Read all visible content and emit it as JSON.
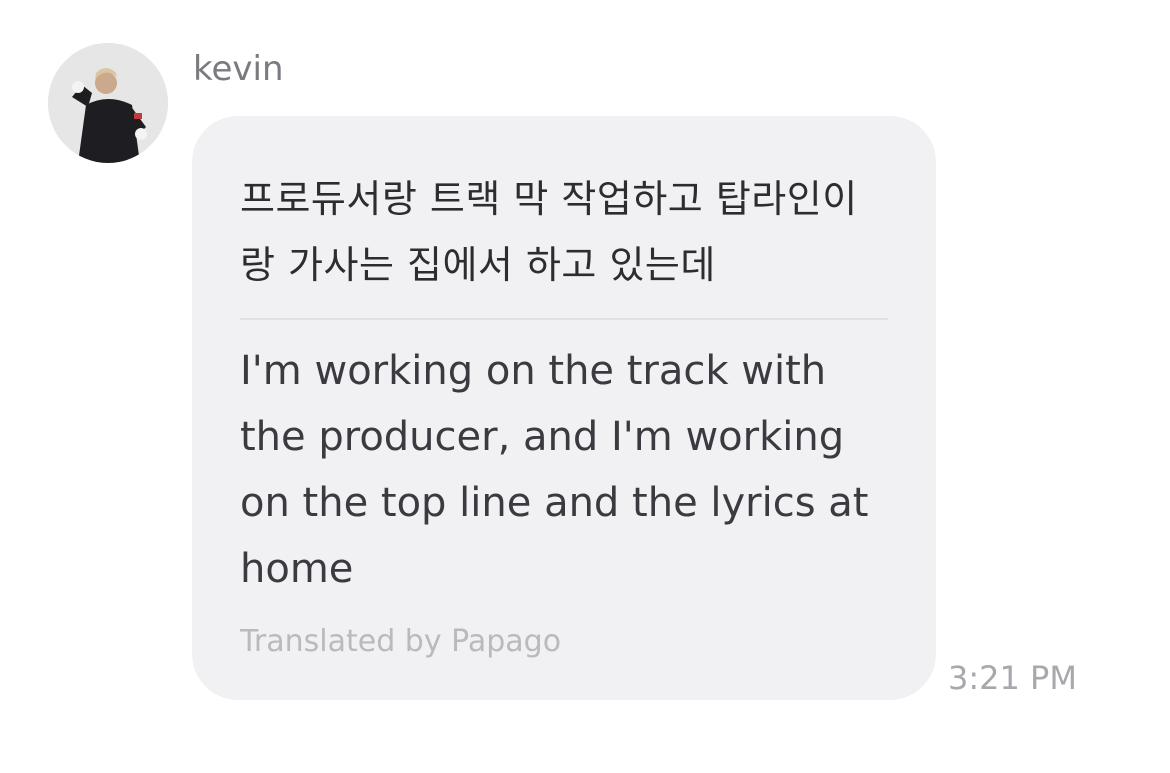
{
  "message": {
    "sender": "kevin",
    "avatar_icon": "profile-photo",
    "original_text": "프로듀서랑 트랙 막 작업하고 탑라인이랑 가사는 집에서 하고 있는데",
    "translated_text": "I'm working on the track with the producer, and I'm working on the top line and the lyrics at home",
    "translation_credit": "Translated by Papago",
    "timestamp": "3:21 PM"
  },
  "colors": {
    "bubble": "#f1f1f4",
    "sender": "#7a7a80",
    "credit": "#b9b9be",
    "timestamp": "#a7a7ad"
  }
}
